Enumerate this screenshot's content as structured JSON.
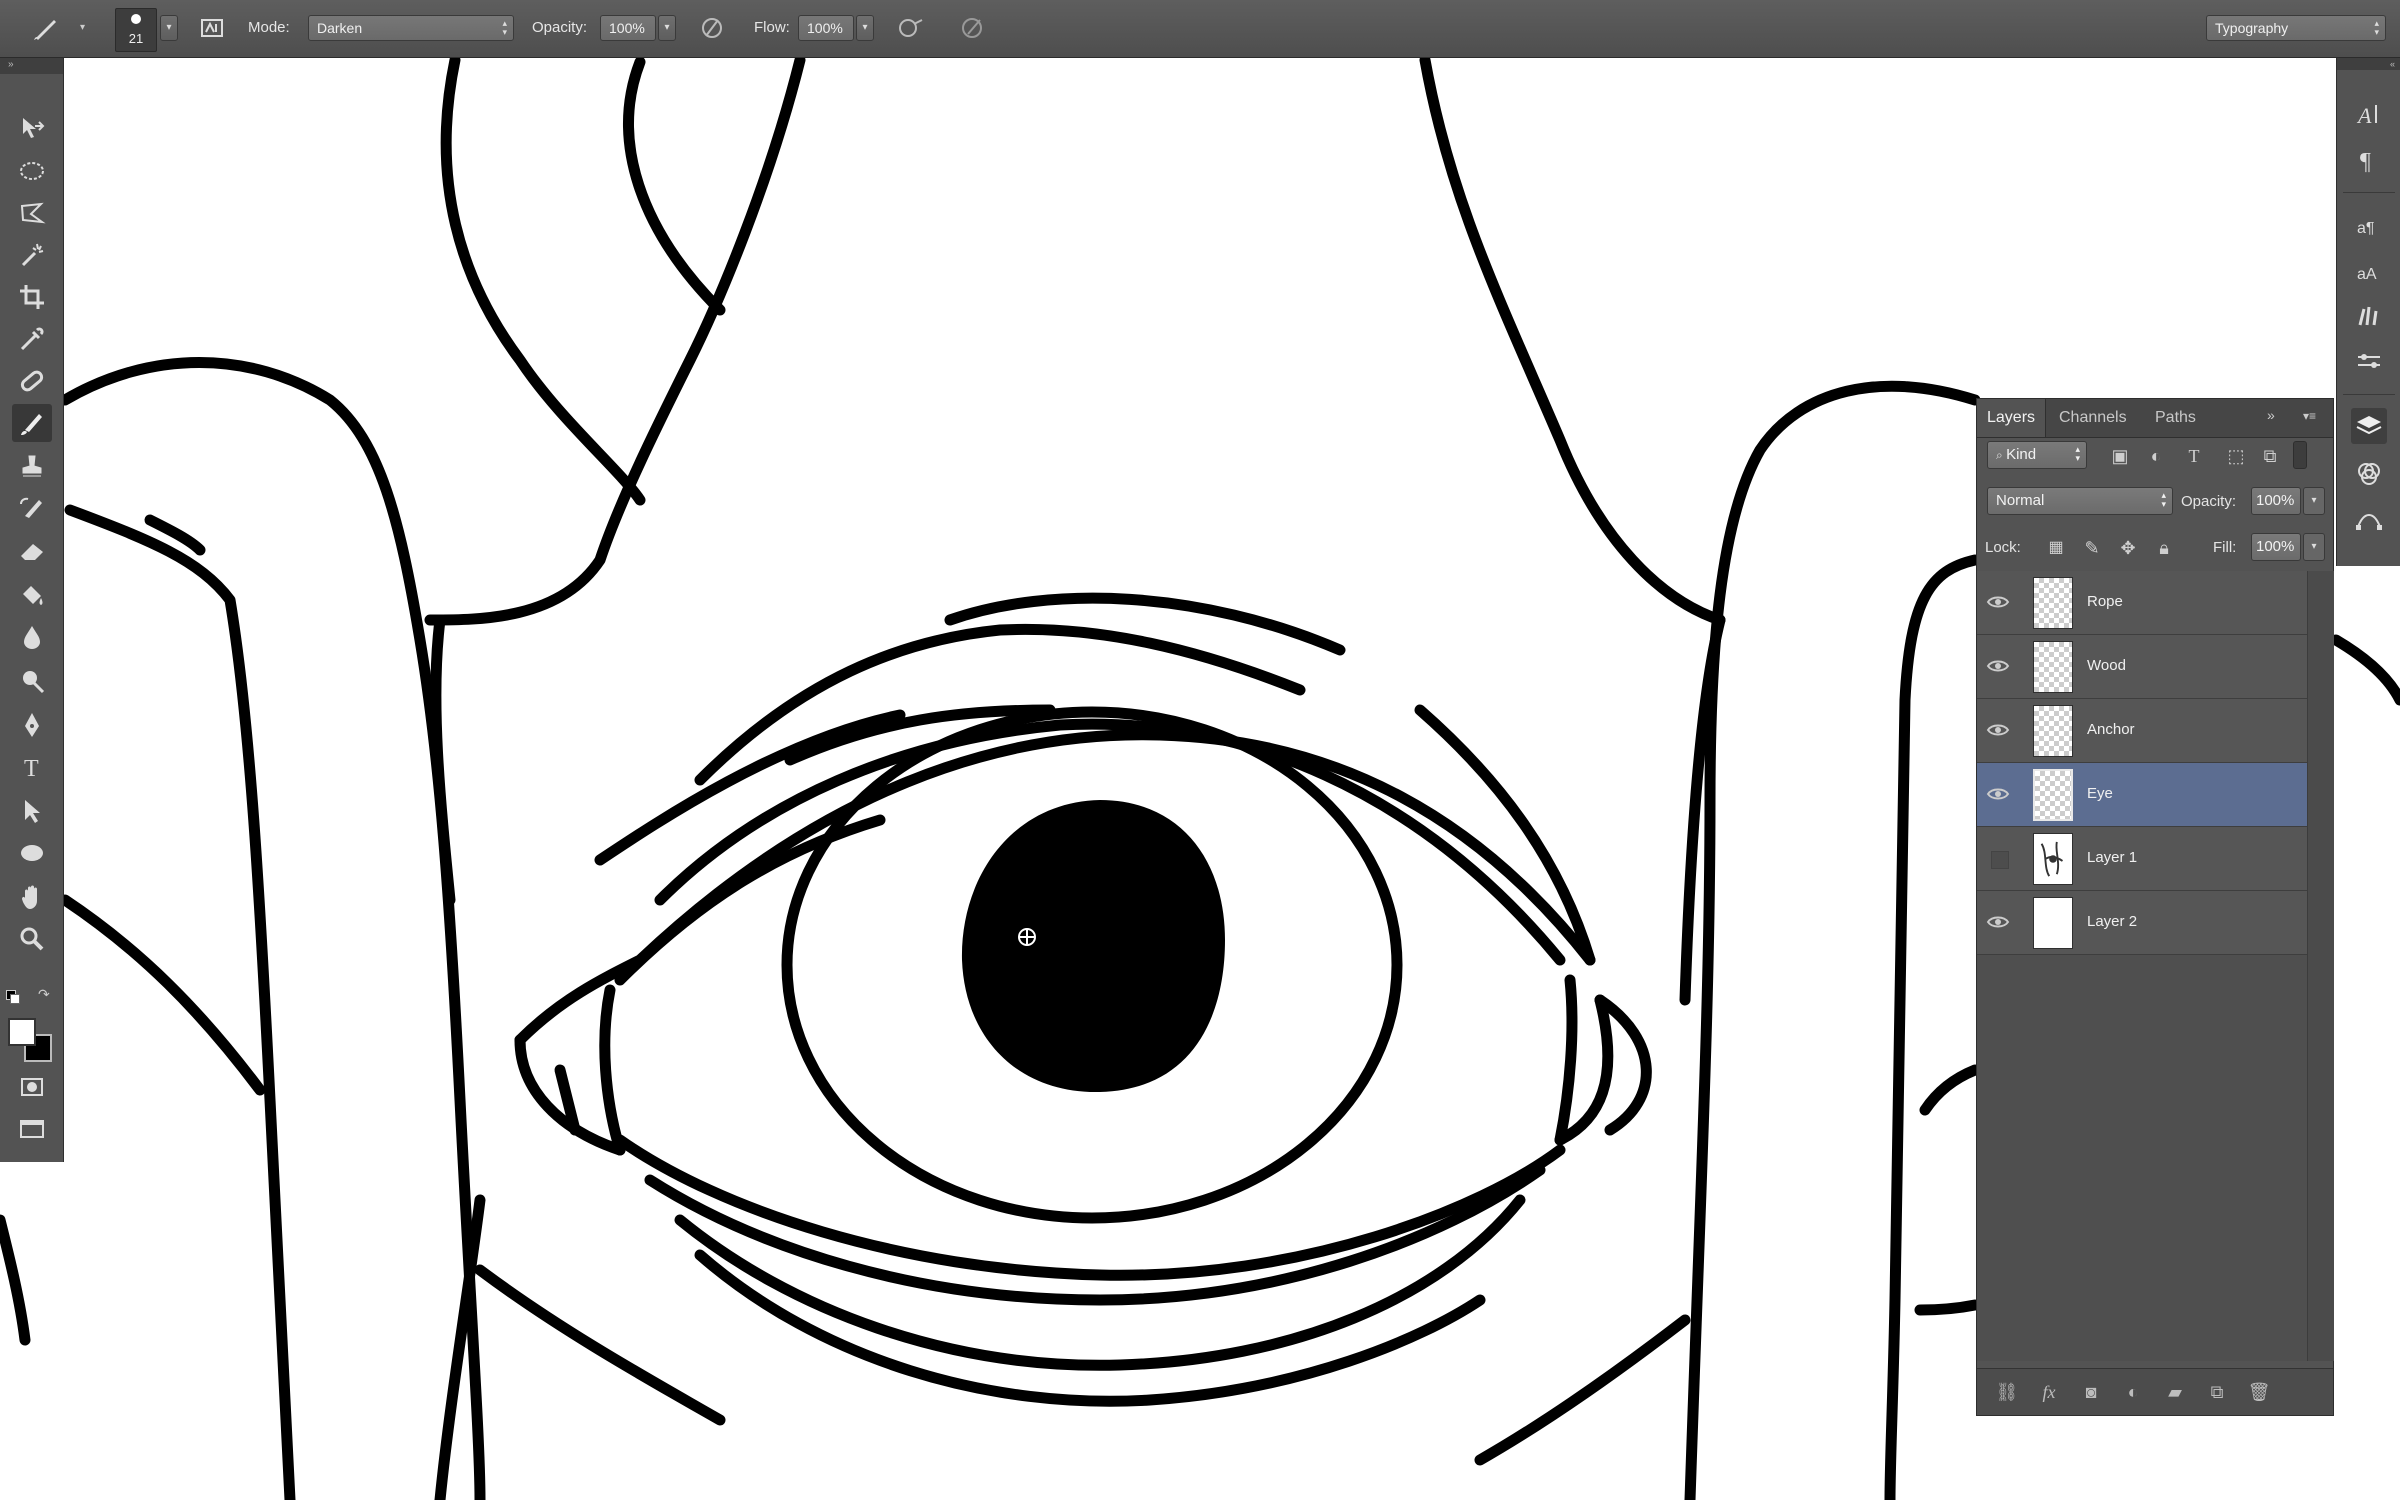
{
  "options_bar": {
    "brush_size": "21",
    "mode_label": "Mode:",
    "mode_value": "Darken",
    "opacity_label": "Opacity:",
    "opacity_value": "100%",
    "flow_label": "Flow:",
    "flow_value": "100%",
    "workspace": "Typography"
  },
  "layers_panel": {
    "tabs": [
      "Layers",
      "Channels",
      "Paths"
    ],
    "filter_kind": "Kind",
    "blend_mode": "Normal",
    "opacity_label": "Opacity:",
    "opacity_value": "100%",
    "lock_label": "Lock:",
    "fill_label": "Fill:",
    "fill_value": "100%",
    "layers": [
      {
        "name": "Rope",
        "visible": true,
        "selected": false
      },
      {
        "name": "Wood",
        "visible": true,
        "selected": false
      },
      {
        "name": "Anchor",
        "visible": true,
        "selected": false
      },
      {
        "name": "Eye",
        "visible": true,
        "selected": true
      },
      {
        "name": "Layer 1",
        "visible": false,
        "selected": false
      },
      {
        "name": "Layer 2",
        "visible": true,
        "selected": false
      }
    ],
    "bottom_icons": [
      "link-icon",
      "fx-icon",
      "mask-icon",
      "adjustment-icon",
      "folder-icon",
      "new-layer-icon",
      "trash-icon"
    ]
  },
  "toolbox": {
    "tools": [
      "move-icon",
      "marquee-icon",
      "lasso-icon",
      "magic-wand-icon",
      "crop-icon",
      "eyedropper-icon",
      "healing-icon",
      "brush-icon",
      "stamp-icon",
      "history-brush-icon",
      "eraser-icon",
      "bucket-icon",
      "blur-icon",
      "dodge-icon",
      "pen-icon",
      "type-icon",
      "path-select-icon",
      "ellipse-icon",
      "hand-icon",
      "zoom-icon"
    ],
    "active_tool": "brush-icon"
  },
  "colors": {
    "ui_dark": "#535353",
    "selection": "#5c6d91",
    "canvas": "#ffffff",
    "ink": "#000000"
  }
}
